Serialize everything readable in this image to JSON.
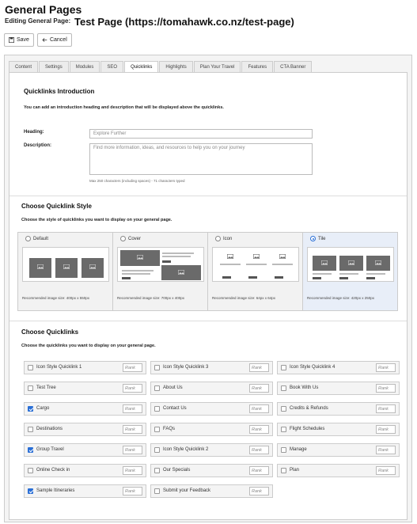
{
  "header": {
    "title": "General Pages",
    "editing_label": "Editing General Page:",
    "editing_page": "Test Page (https://tomahawk.co.nz/test-page)"
  },
  "toolbar": {
    "save_label": "Save",
    "cancel_label": "Cancel"
  },
  "tabs": [
    {
      "label": "Content",
      "active": false
    },
    {
      "label": "Settings",
      "active": false
    },
    {
      "label": "Modules",
      "active": false
    },
    {
      "label": "SEO",
      "active": false
    },
    {
      "label": "Quicklinks",
      "active": true
    },
    {
      "label": "Highlights",
      "active": false
    },
    {
      "label": "Plan Your Travel",
      "active": false
    },
    {
      "label": "Features",
      "active": false
    },
    {
      "label": "CTA Banner",
      "active": false
    }
  ],
  "intro": {
    "title": "Quicklinks Introduction",
    "description": "You can add an introduction heading and description that will be displayed above the quicklinks.",
    "heading_label": "Heading:",
    "heading_value": "Explore Further",
    "description_label": "Description:",
    "description_value": "Find more information, ideas, and resources to help you on your journey",
    "char_hint": "Max 250 characters (including spaces) - 71 characters typed"
  },
  "style": {
    "title": "Choose Quicklink Style",
    "description": "Choose the style of quicklinks you want to display on your general page.",
    "options": [
      {
        "label": "Default",
        "selected": false,
        "rec": "Recommended image size: 400px x 550px"
      },
      {
        "label": "Cover",
        "selected": false,
        "rec": "Recommended image size: 700px x 400px"
      },
      {
        "label": "Icon",
        "selected": false,
        "rec": "Recommended image size: 64px x 64px"
      },
      {
        "label": "Tile",
        "selected": true,
        "rec": "Recommended image size: 420px x 250px"
      }
    ]
  },
  "quicklinks": {
    "title": "Choose Quicklinks",
    "description": "Choose the quicklinks you want to display on your general page.",
    "rank_placeholder": "Rank",
    "items": [
      {
        "label": "Icon Style Quicklink 1",
        "checked": false
      },
      {
        "label": "Icon Style Quicklink 3",
        "checked": false
      },
      {
        "label": "Icon Style Quicklink 4",
        "checked": false
      },
      {
        "label": "Test Tree",
        "checked": false
      },
      {
        "label": "About Us",
        "checked": false
      },
      {
        "label": "Book With Us",
        "checked": false
      },
      {
        "label": "Cargo",
        "checked": true
      },
      {
        "label": "Contact Us",
        "checked": false
      },
      {
        "label": "Credits & Refunds",
        "checked": false
      },
      {
        "label": "Destinations",
        "checked": false
      },
      {
        "label": "FAQs",
        "checked": false
      },
      {
        "label": "Flight Schedules",
        "checked": false
      },
      {
        "label": "Group Travel",
        "checked": true
      },
      {
        "label": "Icon Style Quicklink 2",
        "checked": false
      },
      {
        "label": "Manage",
        "checked": false
      },
      {
        "label": "Online Check in",
        "checked": false
      },
      {
        "label": "Our Specials",
        "checked": false
      },
      {
        "label": "Plan",
        "checked": false
      },
      {
        "label": "Sample Itineraries",
        "checked": true
      },
      {
        "label": "Submit your Feedback",
        "checked": false
      }
    ]
  },
  "colors": {
    "accent": "#2a6fd6",
    "placeholder_image": "#6a6a6a"
  }
}
